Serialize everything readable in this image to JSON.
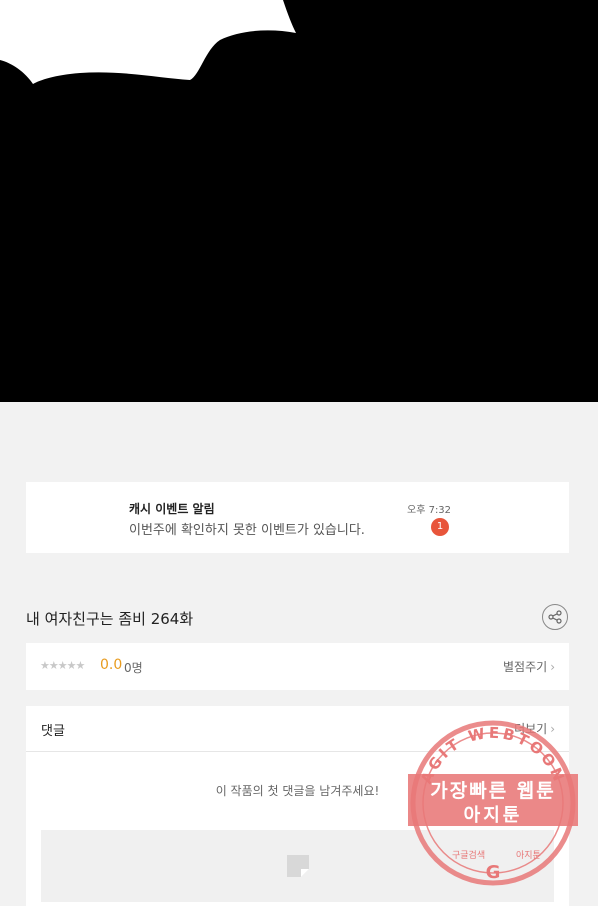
{
  "notification": {
    "title": "캐시 이벤트 알림",
    "body": "이번주에 확인하지 못한 이벤트가 있습니다.",
    "time": "오후 7:32",
    "badge": "1"
  },
  "episode": {
    "title": "내 여자친구는 좀비 264화"
  },
  "rating": {
    "stars": "★★★★★",
    "score": "0.0",
    "count": "0명",
    "rate_label": "별점주기",
    "chevron": "›"
  },
  "comments": {
    "label": "댓글",
    "more_label": "더보기",
    "chevron": "›",
    "empty_message": "이 작품의 첫 댓글을 남겨주세요!"
  },
  "watermark": {
    "ring_top": "AGIT WEBTOON",
    "banner_line1": "가장빠른 웹툰",
    "banner_line2": "아지툰",
    "bottom_left": "구글검색",
    "bottom_right": "아지툰",
    "color": "#e87878"
  },
  "colors": {
    "badge": "#e8553b",
    "score": "#e89b1e",
    "page_bg": "#f2f2f2"
  }
}
